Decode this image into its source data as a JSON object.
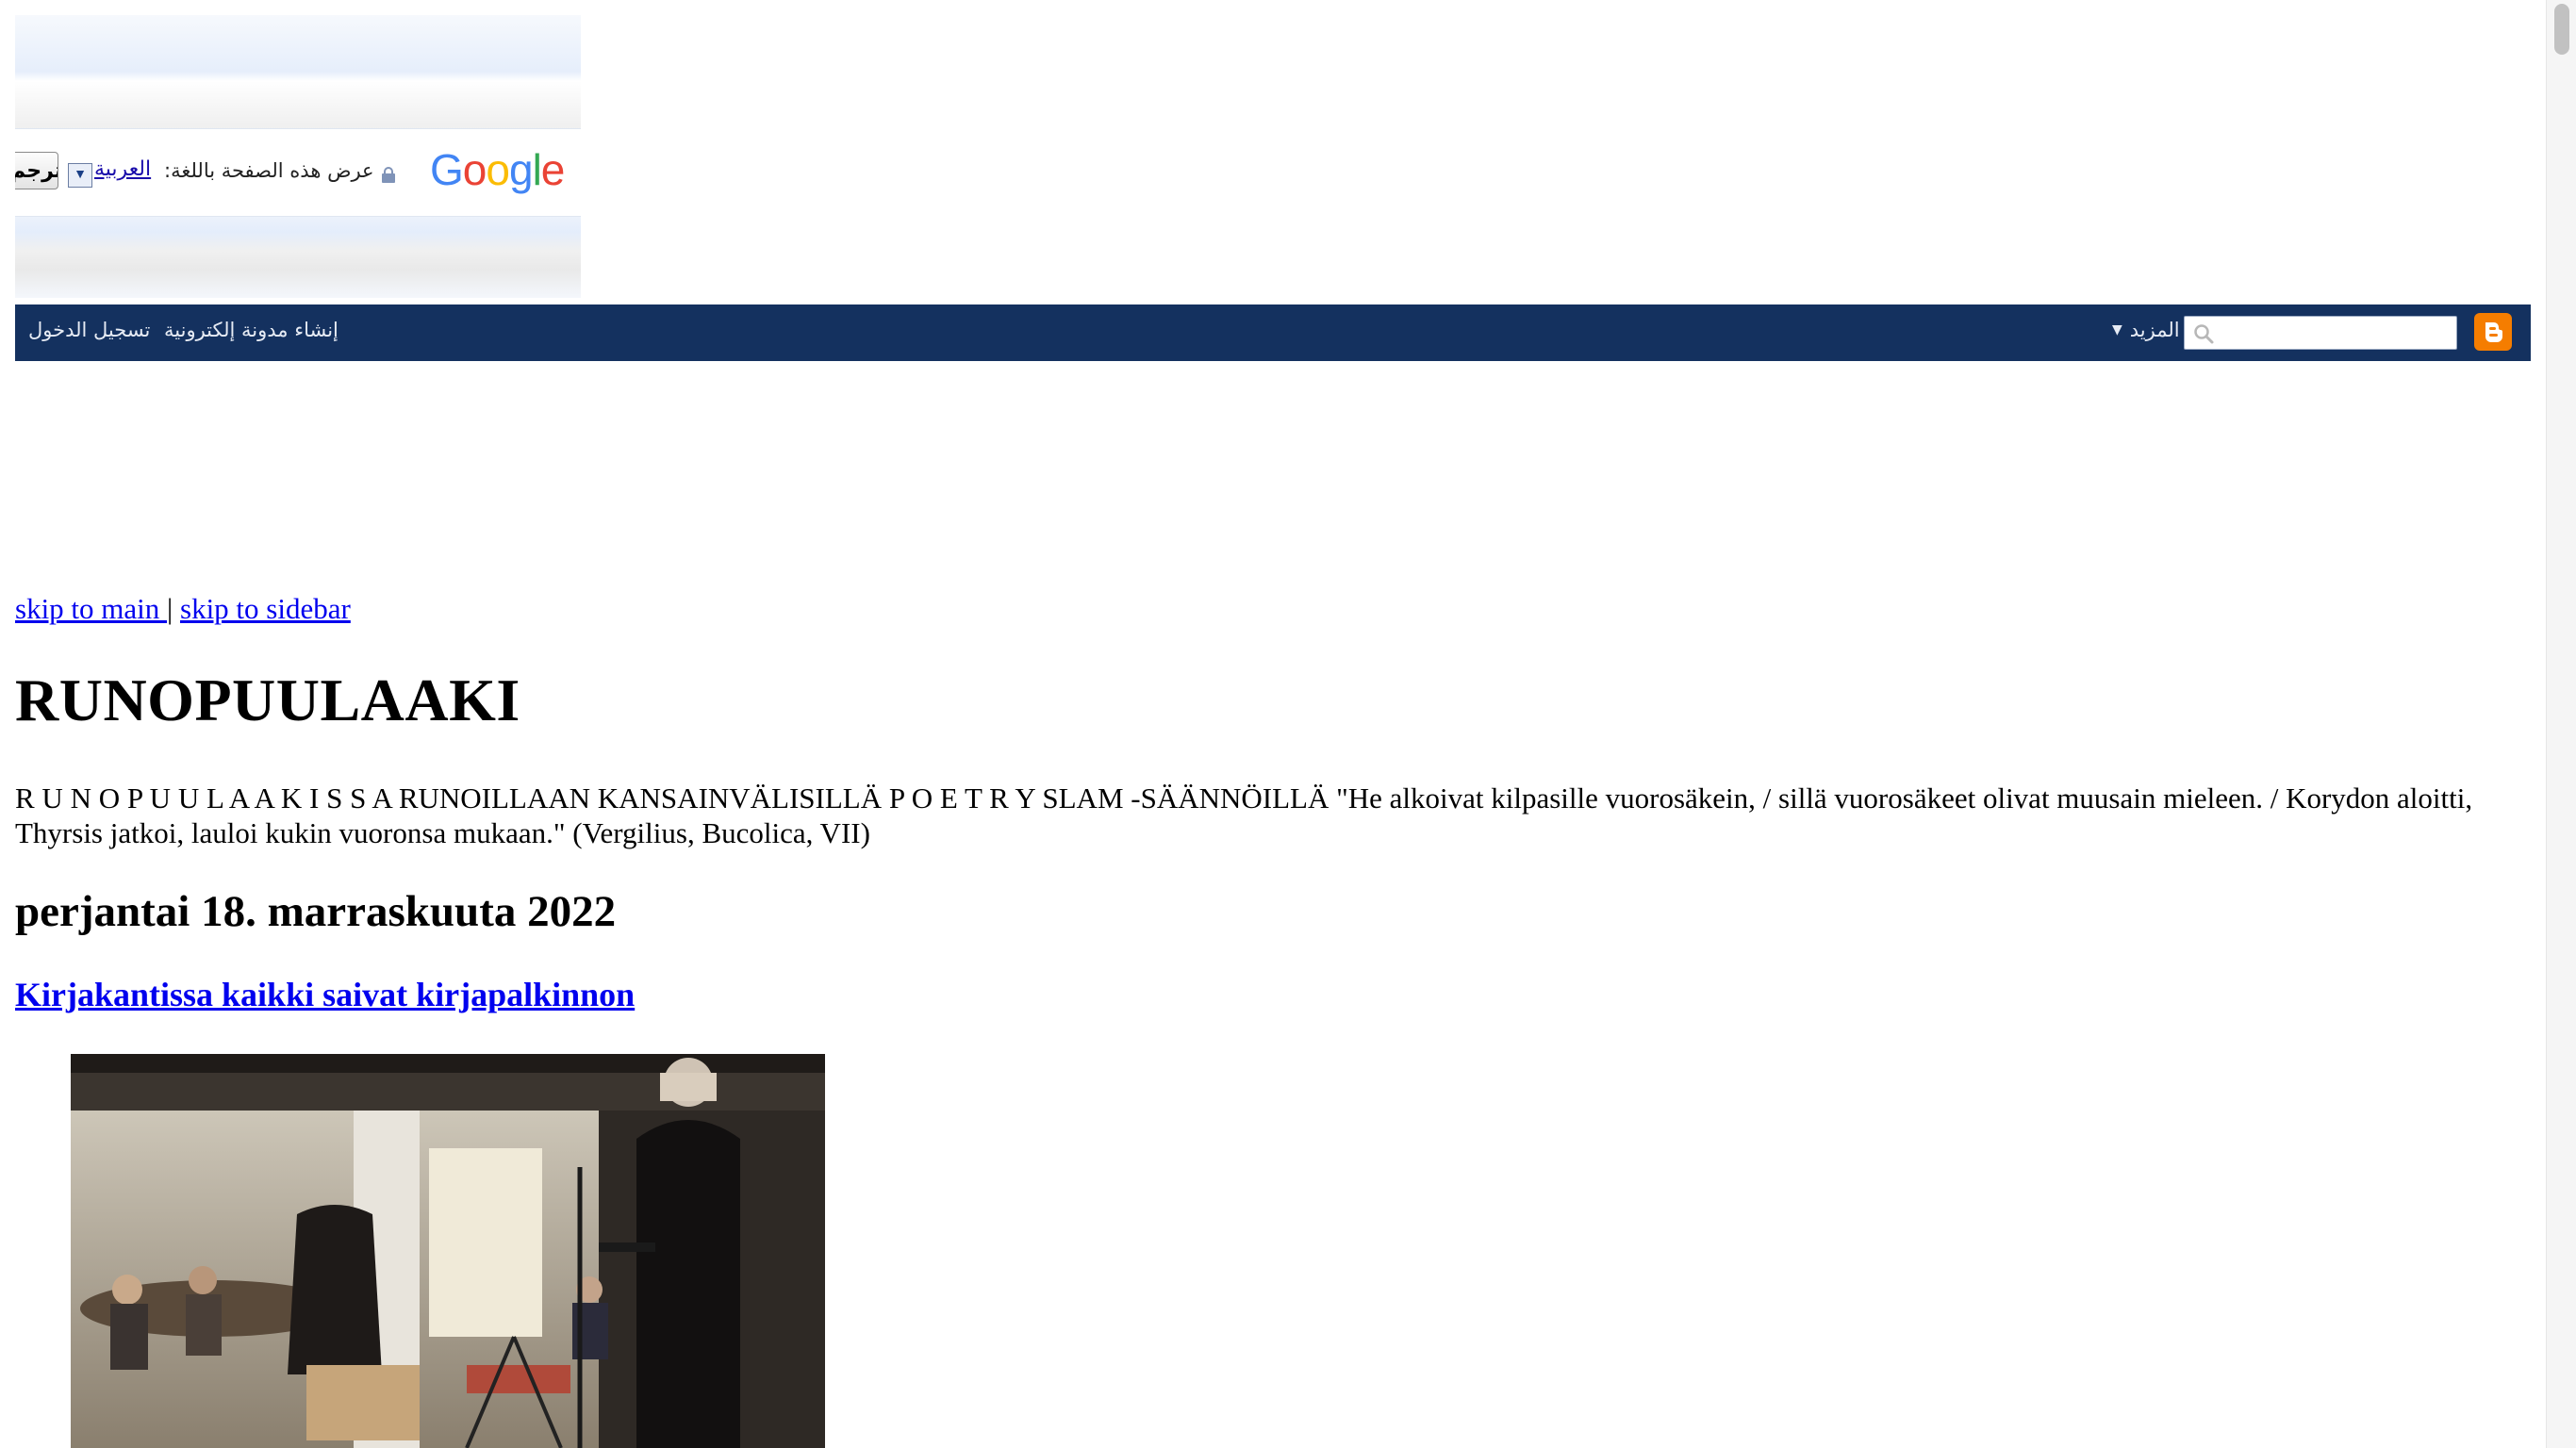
{
  "translate_bar": {
    "translate_button": "ترجم",
    "language_link": "العربية",
    "view_label": "عرض هذه الصفحة باللغة:",
    "logo_text": "Google"
  },
  "navbar": {
    "sign_in": "تسجيل الدخول",
    "create_blog": "إنشاء مدونة إلكترونية",
    "more": "المزيد",
    "search_value": ""
  },
  "skip": {
    "main": "skip to main ",
    "separator": "|",
    "sidebar": "skip to sidebar"
  },
  "blog": {
    "title": "RUNOPUULAAKI",
    "description": "R U N O P U U L A A K I S S A RUNOILLAAN KANSAINVÄLISILLÄ P O E T R Y SLAM -SÄÄNNÖILLÄ \"He alkoivat kilpasille vuorosäkein, / sillä vuorosäkeet olivat muusain mieleen. / Korydon aloitti, Thyrsis jatkoi, lauloi kukin vuoronsa mukaan.\" (Vergilius, Bucolica, VII)"
  },
  "post": {
    "date": "perjantai 18. marraskuuta 2022",
    "title": "Kirjakantissa kaikki saivat kirjapalkinnon"
  },
  "colors": {
    "navbar": "#14315f",
    "link": "#0000ee",
    "blogger_orange": "#f57d00"
  }
}
